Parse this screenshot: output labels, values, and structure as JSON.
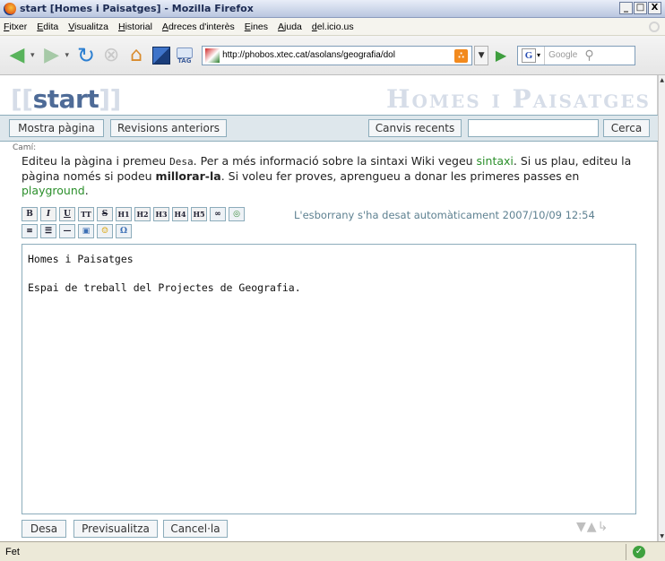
{
  "window": {
    "title": "start [Homes i Paisatges] - Mozilla Firefox",
    "controls": [
      "_",
      "□",
      "X"
    ]
  },
  "menu": {
    "items": [
      "Fitxer",
      "Edita",
      "Visualitza",
      "Historial",
      "Adreces d'interès",
      "Eines",
      "Ajuda",
      "del.icio.us"
    ]
  },
  "nav": {
    "url": "http://phobos.xtec.cat/asolans/geografia/dol",
    "search_engine": "G",
    "search_placeholder": "Google",
    "tag_label": "TAG",
    "icons": [
      "back-icon",
      "forward-icon",
      "reload-icon",
      "stop-icon",
      "home-icon",
      "bookmark-icon",
      "tag-icon",
      "rss-icon",
      "go-icon",
      "search-icon"
    ]
  },
  "page": {
    "title_open": "[[",
    "title_word": "start",
    "title_close": "]]",
    "site_name": "Homes i Paisatges",
    "buttons": {
      "show_page": "Mostra pàgina",
      "old_revisions": "Revisions anteriors",
      "recent_changes": "Canvis recents",
      "search": "Cerca"
    },
    "search_value": "",
    "breadcrumb": "Camí:",
    "intro": {
      "p1": "Editeu la pàgina i premeu ",
      "code": "Desa",
      "p2": ". Per a més informació sobre la sintaxi Wiki vegeu ",
      "link1": "sintaxi",
      "p3": ". Si us plau, editeu la pàgina només si podeu ",
      "bold": "millorar-la",
      "p4": ". Si voleu fer proves, aprengueu a donar les primeres passes en ",
      "link2": "playground",
      "p5": "."
    },
    "toolbar": {
      "row1": [
        "B",
        "I",
        "U",
        "TT",
        "S",
        "H1",
        "H2",
        "H3",
        "H4",
        "H5",
        "∞",
        "◎"
      ],
      "row2": [
        "≡",
        "☰",
        "—",
        "▣",
        "☺",
        "Ω"
      ],
      "draft_status": "L'esborrany s'ha desat automàticament 2007/10/09 12:54"
    },
    "editor_text": "Homes i Paisatges\n\nEspai de treball del Projectes de Geografia.",
    "edit_buttons": {
      "save": "Desa",
      "preview": "Previsualitza",
      "cancel": "Cancel·la"
    }
  },
  "status": {
    "text": "Fet"
  }
}
